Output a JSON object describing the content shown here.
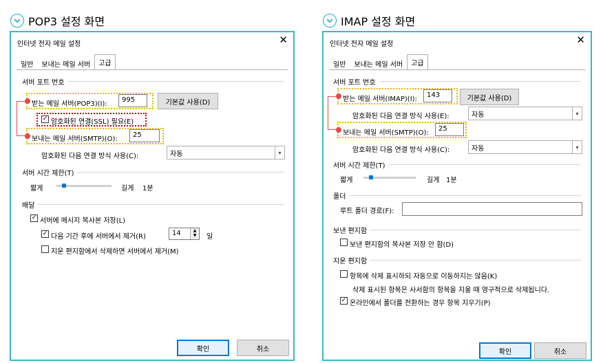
{
  "left": {
    "section_title": "POP3 설정 화면",
    "dialog_title": "인터넷 전자 메일 설정",
    "close": "✕",
    "tabs": [
      "일반",
      "보내는 메일 서버",
      "고급"
    ],
    "group_ports": "서버 포트 번호",
    "incoming_label": "받는 메일 서버(POP3)(I):",
    "incoming_value": "995",
    "default_button": "기본값 사용(D)",
    "ssl_label": "암호화된 연결(SSL) 필요(E)",
    "outgoing_label": "보내는 메일 서버(SMTP)(O):",
    "outgoing_value": "25",
    "encrypt_label": "암호화된 다음 연결 방식 사용(C):",
    "encrypt_value": "자동",
    "group_timeout": "서버 시간 제한(T)",
    "short": "짧게",
    "long": "길게",
    "timeout_value": "1분",
    "timeout_level": 0.1,
    "group_delivery": "배달",
    "leave_copy": "서버에 메시지 복사본 저장(L)",
    "remove_after": "다음 기간 후에 서버에서 제거(R)",
    "days_value": "14",
    "days_unit": "일",
    "remove_deleted": "지운 편지함에서 삭제하면 서버에서 제거(M)",
    "ok": "확인",
    "cancel": "취소",
    "checks": {
      "ssl": true,
      "leave_copy": true,
      "remove_after": true,
      "remove_deleted": false
    }
  },
  "right": {
    "section_title": "IMAP 설정 화면",
    "dialog_title": "인터넷 전자 메일 설정",
    "close": "✕",
    "tabs": [
      "일반",
      "보내는 메일 서버",
      "고급"
    ],
    "group_ports": "서버 포트 번호",
    "incoming_label": "받는 메일 서버(IMAP)(I):",
    "incoming_value": "143",
    "default_button": "기본값 사용(D)",
    "incoming_encrypt_label": "암호화된 다음 연결 방식 사용(E):",
    "incoming_encrypt_value": "자동",
    "outgoing_label": "보내는 메일 서버(SMTP)(O):",
    "outgoing_value": "25",
    "outgoing_encrypt_label": "암호화된 다음 연결 방식 사용(C):",
    "outgoing_encrypt_value": "자동",
    "group_timeout": "서버 시간 제한(T)",
    "short": "짧게",
    "long": "길게",
    "timeout_value": "1분",
    "timeout_level": 0.1,
    "group_folders": "폴더",
    "root_folder_label": "루트 폴더 경로(F):",
    "root_folder_value": "",
    "group_sent": "보낸 편지함",
    "no_sent_copy": "보낸 편지함의 복사본 저장 안 함(D)",
    "group_deleted": "지운 편지함",
    "mark_delete": "항목에 삭제 표시하되 자동으로 이동하지는 않음(K)",
    "mark_delete_note": "삭제 표시된 항목은 사서함의 항목을 지울 때 영구적으로 삭제됩니다.",
    "purge_online": "온라인에서 폴더를 전환하는 경우 항목 지우기(P)",
    "ok": "확인",
    "cancel": "취소",
    "checks": {
      "no_sent_copy": false,
      "mark_delete": false,
      "purge_online": true
    }
  },
  "colors": {
    "accent": "#39b8c9",
    "highlight": "#e6b400",
    "ssl_highlight": "#c00000",
    "connector": "#e8474c",
    "ok_border": "#0078d7"
  },
  "icons": {
    "section_marker": "chevron-down-icon",
    "close": "close-icon",
    "dropdown": "chevron-down-icon",
    "check": "check-icon"
  }
}
